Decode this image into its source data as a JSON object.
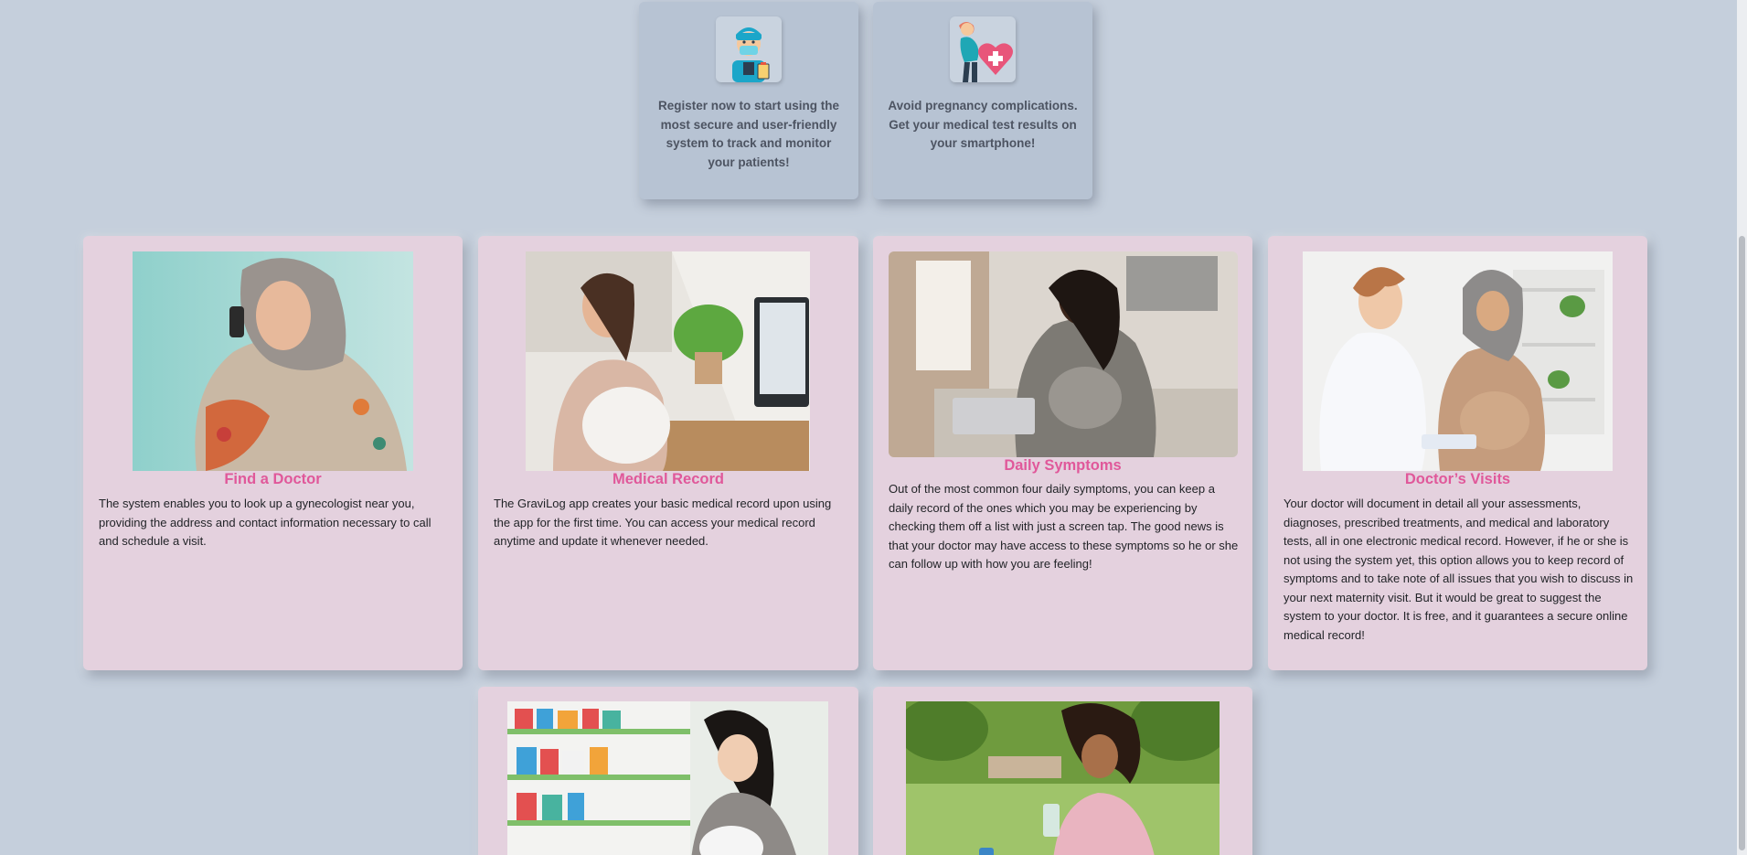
{
  "top_cards": [
    {
      "icon": "doctor-icon",
      "text": "Register now to start using the most secure and user-friendly system to track and monitor your patients!"
    },
    {
      "icon": "pregnant-woman-heart-icon",
      "text": "Avoid pregnancy complications. Get your medical test results on your smartphone!"
    }
  ],
  "features": [
    {
      "title": "Find a Doctor",
      "text": "The system enables you to look up a gynecologist near you, providing the address and contact information necessary to call and schedule a visit.",
      "image": "pregnant-woman-on-phone-photo"
    },
    {
      "title": "Medical Record",
      "text": "The GraviLog app creates your basic medical record upon using the app for the first time. You can access your medical record anytime and update it whenever needed.",
      "image": "pregnant-woman-at-computer-photo"
    },
    {
      "title": "Daily Symptoms",
      "text": "Out of the most common four daily symptoms, you can keep a daily record of the ones which you may be experiencing by checking them off a list with just a screen tap. The good news is that your doctor may have access to these symptoms so he or she can follow up with how you are feeling!",
      "image": "pregnant-woman-with-laptop-photo"
    },
    {
      "title": "Doctor’s Visits",
      "text": "Your doctor will document in detail all your assessments, diagnoses, prescribed treatments, and medical and laboratory tests, all in one electronic medical record. However, if he or she is not using the system yet, this option allows you to keep record of symptoms and to take note of all issues that you wish to discuss in your next maternity visit. But it would be great to suggest the system to your doctor. It is free, and it guarantees a secure online medical record!",
      "image": "doctor-with-pregnant-patient-photo"
    },
    {
      "title": "",
      "text": "",
      "image": "pregnant-woman-in-pharmacy-photo"
    },
    {
      "title": "",
      "text": "",
      "image": "pregnant-woman-in-park-photo"
    }
  ],
  "colors": {
    "background": "#c5cfdc",
    "top_card": "#b7c3d3",
    "feature_card": "#e4d1de",
    "title_accent": "#e0589a"
  }
}
